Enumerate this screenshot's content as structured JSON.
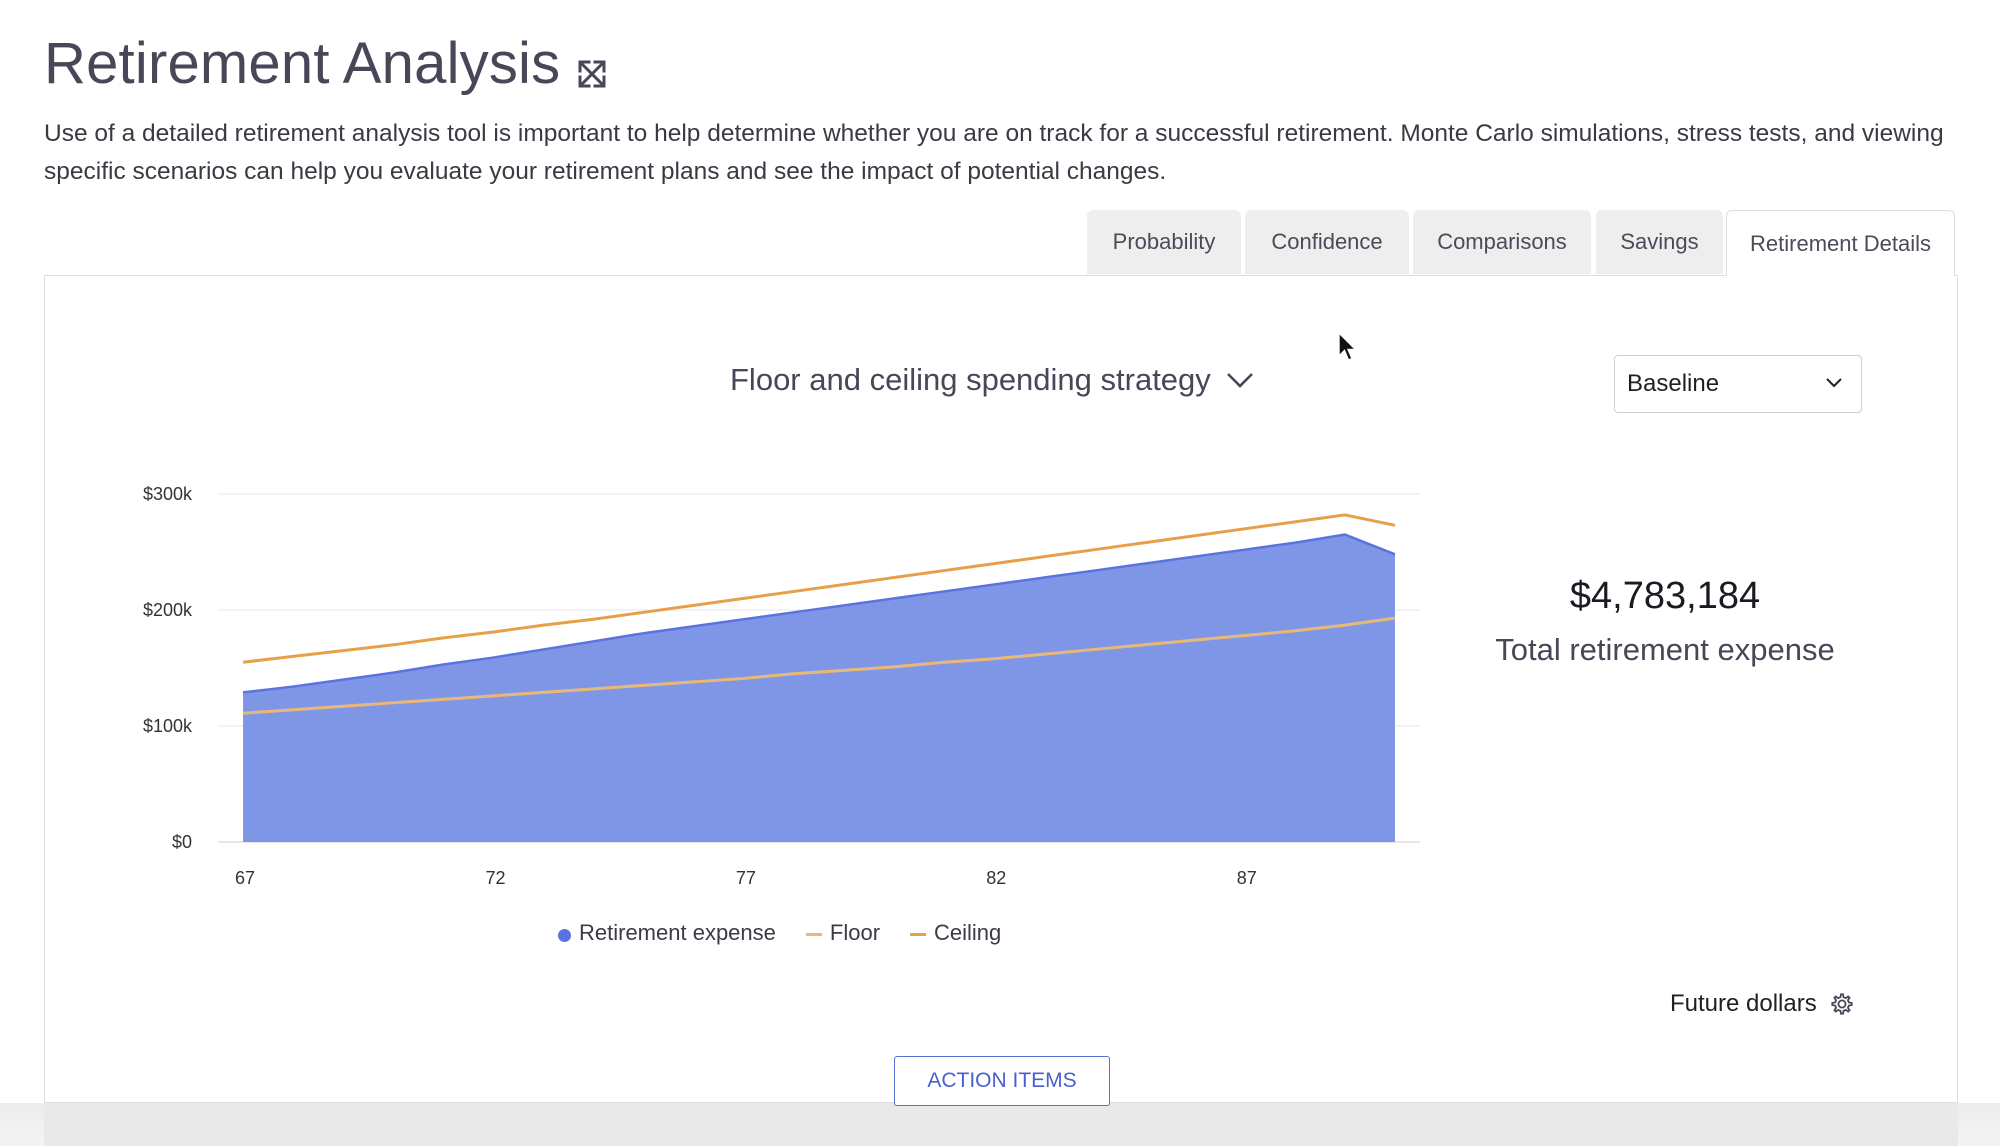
{
  "page": {
    "title": "Retirement Analysis",
    "description": "Use of a detailed retirement analysis tool is important to help determine whether you are on track for a successful retirement. Monte Carlo simulations, stress tests, and viewing specific scenarios can help you evaluate your retirement plans and see the impact of potential changes."
  },
  "tabs": [
    {
      "label": "Probability",
      "active": false
    },
    {
      "label": "Confidence",
      "active": false
    },
    {
      "label": "Comparisons",
      "active": false
    },
    {
      "label": "Savings",
      "active": false
    },
    {
      "label": "Retirement Details",
      "active": true
    }
  ],
  "strategy": {
    "label": "Floor and ceiling spending strategy"
  },
  "scenario": {
    "selected": "Baseline"
  },
  "summary": {
    "total_value": "$4,783,184",
    "total_label": "Total retirement expense"
  },
  "dollars": {
    "label": "Future dollars"
  },
  "action_button": {
    "label": "ACTION ITEMS"
  },
  "colors": {
    "expense": "#5b73e0",
    "expense_fill": "#7f96e6",
    "floor": "#e8b878",
    "ceiling": "#e6a04a"
  },
  "icons": [
    "expand-icon",
    "chevron-down-icon",
    "gear-icon",
    "mouse-cursor-icon"
  ],
  "chart_data": {
    "type": "area",
    "x_tick_labels": [
      "67",
      "72",
      "77",
      "82",
      "87"
    ],
    "y_tick_labels": [
      "$0",
      "$100k",
      "$200k",
      "$300k"
    ],
    "ylim": [
      0,
      300000
    ],
    "xlim": [
      66.5,
      90.5
    ],
    "grid": true,
    "legend_position": "bottom",
    "x": [
      67,
      68,
      69,
      70,
      71,
      72,
      73,
      74,
      75,
      76,
      77,
      78,
      79,
      80,
      81,
      82,
      83,
      84,
      85,
      86,
      87,
      88,
      89,
      90
    ],
    "series": [
      {
        "name": "Retirement expense",
        "type": "area",
        "values": [
          129000,
          134000,
          140000,
          146000,
          153000,
          159000,
          166000,
          173000,
          180000,
          186000,
          192000,
          198000,
          204000,
          210000,
          216000,
          222000,
          228000,
          234000,
          240000,
          246000,
          252000,
          258000,
          265000,
          248000
        ]
      },
      {
        "name": "Floor",
        "type": "line",
        "values": [
          111000,
          114000,
          117000,
          120000,
          123000,
          126000,
          129000,
          132000,
          135000,
          138000,
          141000,
          145000,
          148000,
          151000,
          155000,
          158000,
          162000,
          166000,
          170000,
          174000,
          178000,
          182000,
          187000,
          193000
        ]
      },
      {
        "name": "Ceiling",
        "type": "line",
        "values": [
          155000,
          160000,
          165000,
          170000,
          176000,
          181000,
          187000,
          192000,
          198000,
          204000,
          210000,
          216000,
          222000,
          228000,
          234000,
          240000,
          246000,
          252000,
          258000,
          264000,
          270000,
          276000,
          282000,
          273000
        ]
      }
    ]
  }
}
